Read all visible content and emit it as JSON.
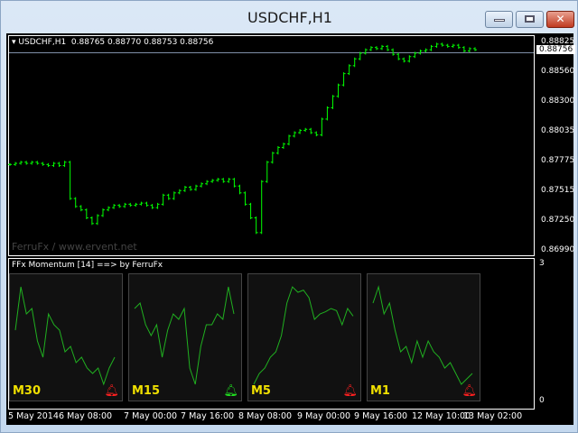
{
  "window": {
    "title": "USDCHF,H1",
    "min": "–",
    "max": "□",
    "close": "✕"
  },
  "chart": {
    "header": "USDCHF,H1  0.88765 0.88770 0.88753 0.88756",
    "watermark": "FerruFx / www.ervent.net",
    "current_price": "0.88756",
    "price_ticks": [
      "0.88825",
      "0.88560",
      "0.88300",
      "0.88035",
      "0.87775",
      "0.87515",
      "0.87250",
      "0.86990"
    ],
    "time_ticks": [
      "5 May 2014",
      "6 May 08:00",
      "7 May 00:00",
      "7 May 16:00",
      "8 May 08:00",
      "9 May 00:00",
      "9 May 16:00",
      "12 May 10:00",
      "13 May 02:00"
    ]
  },
  "indicator": {
    "title": "FFx Momentum [14] ==> by FerruFx",
    "scale_max": "3",
    "scale_min": "0",
    "panels": [
      {
        "label": "M30",
        "alert_color": "#ff2020",
        "values": [
          0.55,
          0.95,
          0.7,
          0.75,
          0.45,
          0.3,
          0.7,
          0.6,
          0.55,
          0.35,
          0.4,
          0.25,
          0.3,
          0.2,
          0.15,
          0.2,
          0.05,
          0.2,
          0.3
        ]
      },
      {
        "label": "M15",
        "alert_color": "#20e020",
        "values": [
          0.75,
          0.8,
          0.6,
          0.5,
          0.6,
          0.3,
          0.55,
          0.7,
          0.65,
          0.75,
          0.2,
          0.05,
          0.4,
          0.6,
          0.6,
          0.7,
          0.65,
          0.95,
          0.7
        ]
      },
      {
        "label": "M5",
        "alert_color": "#ff2020",
        "values": [
          0.05,
          0.15,
          0.2,
          0.3,
          0.35,
          0.5,
          0.8,
          0.95,
          0.9,
          0.92,
          0.85,
          0.65,
          0.7,
          0.72,
          0.75,
          0.73,
          0.6,
          0.75,
          0.68
        ]
      },
      {
        "label": "M1",
        "alert_color": "#ff2020",
        "values": [
          0.8,
          0.95,
          0.7,
          0.8,
          0.55,
          0.35,
          0.4,
          0.25,
          0.45,
          0.3,
          0.45,
          0.35,
          0.3,
          0.2,
          0.25,
          0.15,
          0.05,
          0.1,
          0.15
        ]
      }
    ]
  },
  "chart_data": {
    "type": "bar",
    "ylim": [
      0.8699,
      0.88825
    ],
    "closes": [
      0.8775,
      0.8776,
      0.8777,
      0.8776,
      0.8777,
      0.8776,
      0.8775,
      0.8774,
      0.8776,
      0.8774,
      0.8777,
      0.8745,
      0.8738,
      0.8735,
      0.8728,
      0.8723,
      0.873,
      0.8735,
      0.8737,
      0.8739,
      0.8738,
      0.874,
      0.8739,
      0.874,
      0.8741,
      0.8739,
      0.8737,
      0.874,
      0.8748,
      0.8745,
      0.875,
      0.8752,
      0.8755,
      0.8753,
      0.8756,
      0.8758,
      0.876,
      0.8761,
      0.8762,
      0.876,
      0.8762,
      0.8756,
      0.875,
      0.874,
      0.8728,
      0.8715,
      0.876,
      0.8777,
      0.8785,
      0.879,
      0.8793,
      0.88,
      0.8803,
      0.8805,
      0.8806,
      0.8803,
      0.8801,
      0.8815,
      0.8825,
      0.8835,
      0.8845,
      0.8855,
      0.8862,
      0.8868,
      0.8873,
      0.8876,
      0.8878,
      0.8877,
      0.8879,
      0.8876,
      0.8872,
      0.8868,
      0.8866,
      0.887,
      0.8873,
      0.8875,
      0.8876,
      0.8879,
      0.8881,
      0.888,
      0.8879,
      0.888,
      0.8878,
      0.8875,
      0.8877,
      0.8876
    ]
  }
}
